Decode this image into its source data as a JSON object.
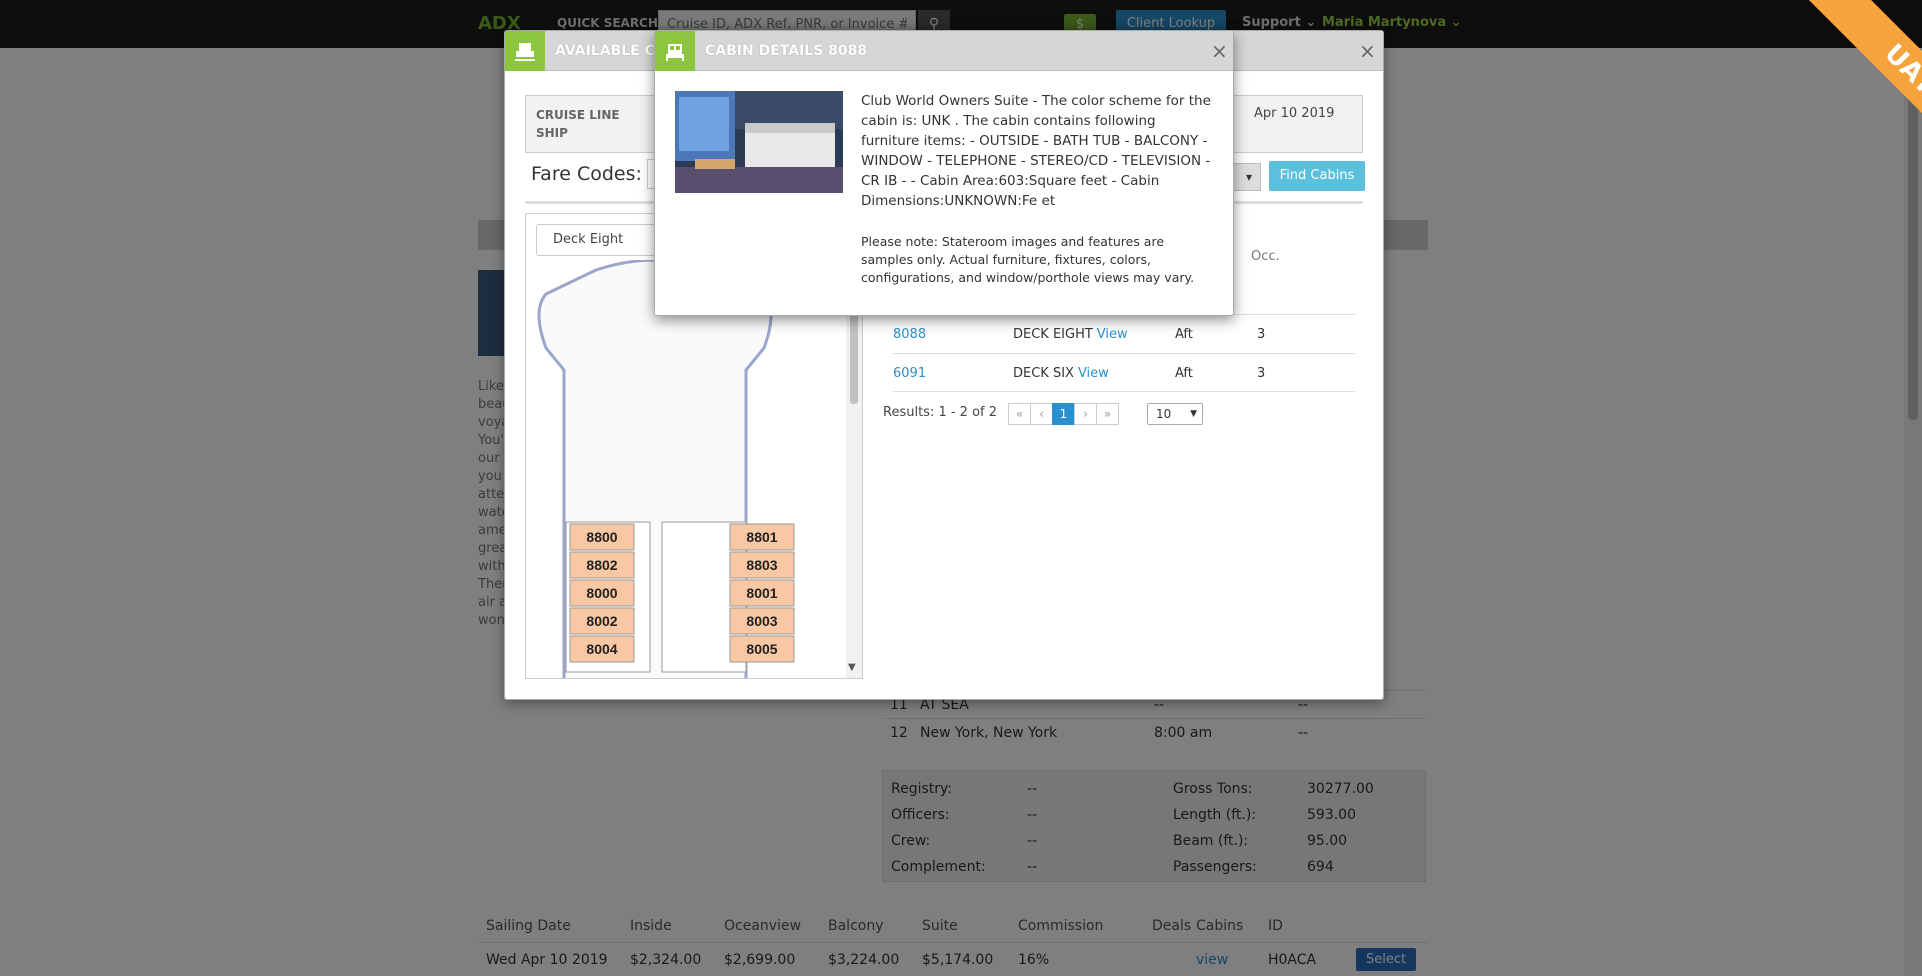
{
  "topbar": {
    "logo": "ADX",
    "quick_search_label": "QUICK SEARCH",
    "search_placeholder": "Cruise ID, ADX Ref, PNR, or Invoice #",
    "dollar_label": "$",
    "client_lookup": "Client Lookup",
    "support": "Support",
    "user": "Maria Martynova",
    "env_badge": "UAT"
  },
  "background": {
    "left_text": "Like beau voya You' our l you atte wate ame grea with Ther air a won",
    "itinerary": [
      {
        "day": "11",
        "port": "AT SEA",
        "time": "--",
        "extra": "--"
      },
      {
        "day": "12",
        "port": "New York, New York",
        "time": "8:00 am",
        "extra": "--"
      }
    ],
    "ship_stats": {
      "registry_label": "Registry:",
      "registry": "--",
      "officers_label": "Officers:",
      "officers": "--",
      "crew_label": "Crew:",
      "crew": "--",
      "complement_label": "Complement:",
      "complement": "--",
      "gross_tons_label": "Gross Tons:",
      "gross_tons": "30277.00",
      "length_label": "Length (ft.):",
      "length": "593.00",
      "beam_label": "Beam (ft.):",
      "beam": "95.00",
      "passengers_label": "Passengers:",
      "passengers": "694"
    },
    "sailings": {
      "headers": [
        "Sailing Date",
        "Inside",
        "Oceanview",
        "Balcony",
        "Suite",
        "Commission",
        "Deals",
        "Cabins",
        "ID"
      ],
      "rows": [
        {
          "date": "Wed Apr 10 2019",
          "inside": "$2,324.00",
          "oceanview": "$2,699.00",
          "balcony": "$3,224.00",
          "suite": "$5,174.00",
          "commission": "16%",
          "deals": "",
          "cabins": "view",
          "id": "H0ACA",
          "action": "Select"
        }
      ]
    }
  },
  "available_cabins": {
    "title": "AVAILABLE CA",
    "cruise_line_label": "CRUISE LINE",
    "ship_label": "SHIP",
    "sail_date": "Apr 10 2019",
    "fare_codes_label": "Fare Codes:",
    "find_cabins": "Find Cabins",
    "deck_select": "Deck Eight",
    "deck_cabins_left": [
      "8800",
      "8802",
      "8000",
      "8002",
      "8004"
    ],
    "deck_cabins_right": [
      "8801",
      "8803",
      "8001",
      "8003",
      "8005"
    ],
    "occ_header": "Occ.",
    "rows": [
      {
        "cabin": "8088",
        "deck": "DECK EIGHT",
        "view": "View",
        "position": "Aft",
        "occ": "3"
      },
      {
        "cabin": "6091",
        "deck": "DECK SIX",
        "view": "View",
        "position": "Aft",
        "occ": "3"
      }
    ],
    "results": "Results: 1 - 2 of 2",
    "pager": {
      "first": "«",
      "prev": "‹",
      "current": "1",
      "next": "›",
      "last": "»"
    },
    "page_size": "10"
  },
  "cabin_details": {
    "title": "CABIN DETAILS 8088",
    "description": "Club World Owners Suite - The color scheme for the cabin is: UNK . The cabin contains following furniture items: - OUTSIDE - BATH TUB - BALCONY - WINDOW - TELEPHONE - STEREO/CD - TELEVISION - CR IB - - Cabin Area:603:Square feet - Cabin Dimensions:UNKNOWN:Fe et",
    "note": "Please note: Stateroom images and features are samples only. Actual furniture, fixtures, colors, configurations, and window/porthole views may vary.",
    "close": "×"
  },
  "dialog_close": "×"
}
